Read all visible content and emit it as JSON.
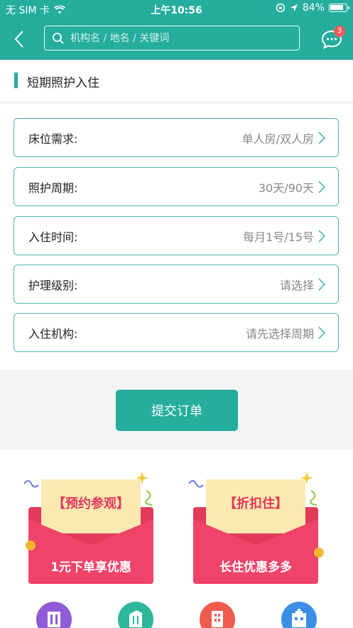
{
  "status_bar": {
    "carrier": "无 SIM 卡",
    "time": "上午10:56",
    "battery": "84%"
  },
  "nav": {
    "search_placeholder": "机构名 / 地名 / 关键词",
    "message_badge": "3"
  },
  "section": {
    "title": "短期照护入住"
  },
  "form": {
    "rows": [
      {
        "label": "床位需求:",
        "value": "单人房/双人房"
      },
      {
        "label": "照护周期:",
        "value": "30天/90天"
      },
      {
        "label": "入住时间:",
        "value": "每月1号/15号"
      },
      {
        "label": "护理级别:",
        "value": "请选择"
      },
      {
        "label": "入住机构:",
        "value": "请先选择周期"
      }
    ]
  },
  "submit": {
    "label": "提交订单"
  },
  "promos": [
    {
      "banner": "【预约参观】",
      "caption": "1元下单享优惠"
    },
    {
      "banner": "【折扣住】",
      "caption": "长住优惠多多"
    }
  ],
  "colors": {
    "brand": "#25ad9e",
    "row_border": "#4db8ac",
    "envelope": "#f0436a",
    "paper": "#fbe9b1",
    "badge": "#f25c5c"
  },
  "bottom_icons": [
    {
      "icon": "building-icon",
      "color": "#8f5bd6"
    },
    {
      "icon": "tower-icon",
      "color": "#2fb79b"
    },
    {
      "icon": "office-icon",
      "color": "#ef5b4e"
    },
    {
      "icon": "hospital-icon",
      "color": "#3b8fe6"
    }
  ]
}
